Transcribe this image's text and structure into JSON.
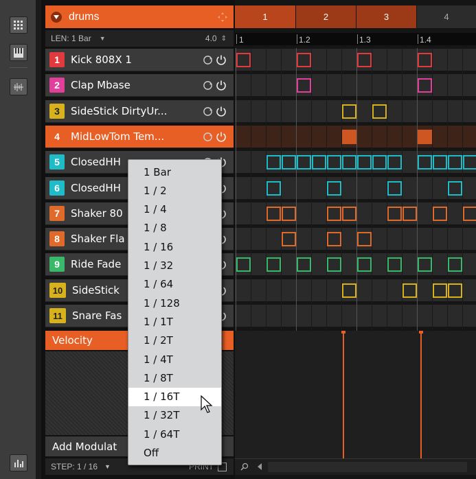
{
  "pattern": {
    "name": "drums"
  },
  "len": {
    "label": "LEN: 1 Bar",
    "value": "4.0"
  },
  "bars": [
    "1",
    "2",
    "3",
    "4"
  ],
  "ruler": [
    "1",
    "1.2",
    "1.3",
    "1.4"
  ],
  "sounds": [
    {
      "num": "1",
      "name": "Kick 808X 1",
      "color": "#e03a3f"
    },
    {
      "num": "2",
      "name": "Clap Mbase",
      "color": "#e0409a"
    },
    {
      "num": "3",
      "name": "SideStick DirtyUr...",
      "color": "#d8b21c"
    },
    {
      "num": "4",
      "name": "MidLowTom Tem...",
      "color": "#e85f26"
    },
    {
      "num": "5",
      "name": "ClosedHH",
      "color": "#1fbcc7"
    },
    {
      "num": "6",
      "name": "ClosedHH",
      "color": "#1fbcc7"
    },
    {
      "num": "7",
      "name": "Shaker 80",
      "color": "#e06a2a"
    },
    {
      "num": "8",
      "name": "Shaker Fla",
      "color": "#e06a2a"
    },
    {
      "num": "9",
      "name": "Ride Fade",
      "color": "#39b86a"
    },
    {
      "num": "10",
      "name": "SideStick",
      "color": "#d8b21c"
    },
    {
      "num": "11",
      "name": "Snare Fas",
      "color": "#d8b21c"
    }
  ],
  "velocity": {
    "label": "Velocity"
  },
  "modulation": {
    "label": "Add Modulat"
  },
  "step": {
    "label": "STEP: 1 / 16",
    "print": "PRINT"
  },
  "dropdown": {
    "options": [
      "1 Bar",
      "1 / 2",
      "1 / 4",
      "1 / 8",
      "1 / 16",
      "1 / 32",
      "1 / 64",
      "1 / 128",
      "1 / 1T",
      "1 / 2T",
      "1 / 4T",
      "1 / 8T",
      "1 / 16T",
      "1 / 32T",
      "1 / 64T",
      "Off"
    ],
    "selected": "1 / 16T"
  },
  "colors": {
    "accent": "#e85f26"
  },
  "icons": [
    "grid-icon",
    "piano-icon",
    "waveform-icon",
    "mixer-icon",
    "chevron-down-icon",
    "drag-icon",
    "loop-icon",
    "power-icon",
    "search-icon",
    "arrow-left-icon"
  ]
}
